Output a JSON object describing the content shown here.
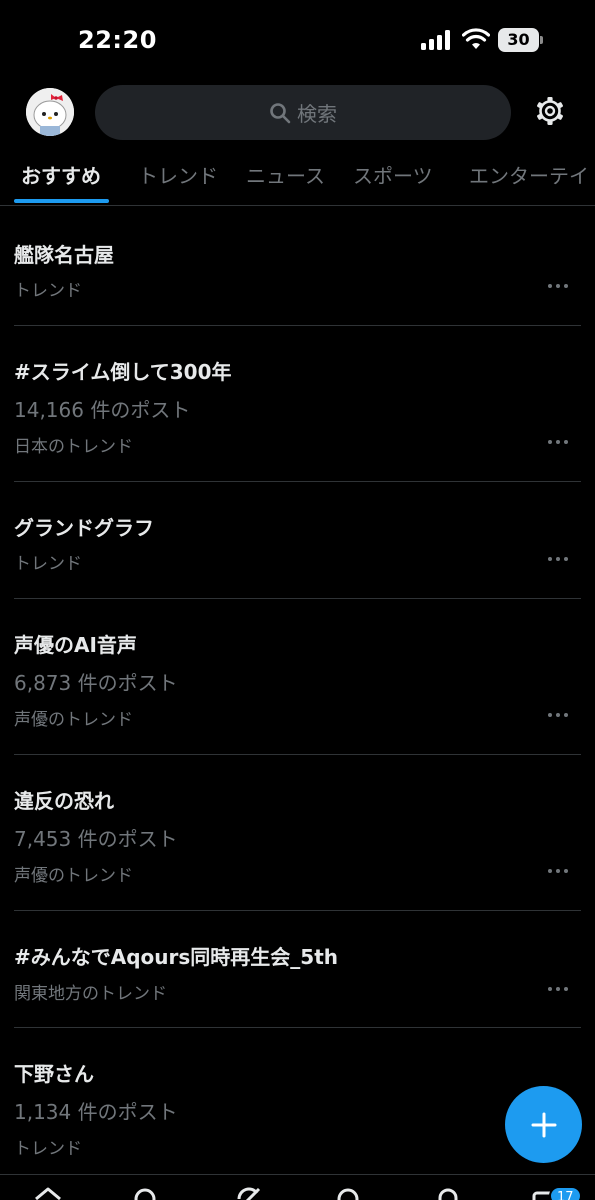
{
  "status_bar": {
    "time": "22:20",
    "battery_level": "30",
    "icons": [
      "signal-icon",
      "wifi-icon",
      "battery-icon"
    ]
  },
  "header": {
    "search_placeholder": "検索",
    "icons": [
      "avatar",
      "search-icon",
      "gear-icon"
    ]
  },
  "tabs": [
    {
      "label": "おすすめ",
      "active": true
    },
    {
      "label": "トレンド",
      "active": false
    },
    {
      "label": "ニュース",
      "active": false
    },
    {
      "label": "スポーツ",
      "active": false
    },
    {
      "label": "エンターテイ",
      "active": false
    }
  ],
  "trends": [
    {
      "title": "艦隊名古屋",
      "count": "",
      "context": "トレンド"
    },
    {
      "title": "#スライム倒して300年",
      "count": "14,166 件のポスト",
      "context": "日本のトレンド"
    },
    {
      "title": "グランドグラフ",
      "count": "",
      "context": "トレンド"
    },
    {
      "title": "声優のAI音声",
      "count": "6,873 件のポスト",
      "context": "声優のトレンド"
    },
    {
      "title": "違反の恐れ",
      "count": "7,453 件のポスト",
      "context": "声優のトレンド"
    },
    {
      "title": "#みんなでAqours同時再生会_5th",
      "count": "",
      "context": "関東地方のトレンド"
    },
    {
      "title": "下野さん",
      "count": "1,134 件のポスト",
      "context": "トレンド"
    }
  ],
  "fab": {
    "icon": "plus-icon"
  },
  "bottom_nav": {
    "icons": [
      "home-icon",
      "search-icon",
      "grok-icon",
      "communities-icon",
      "notifications-icon",
      "messages-icon"
    ],
    "badge_count": "17"
  },
  "colors": {
    "background": "#000000",
    "accent": "#1d9bf0",
    "text_primary": "#e7e9ea",
    "text_secondary": "#71767b",
    "divider": "#2f3336",
    "search_bg": "#202327"
  }
}
